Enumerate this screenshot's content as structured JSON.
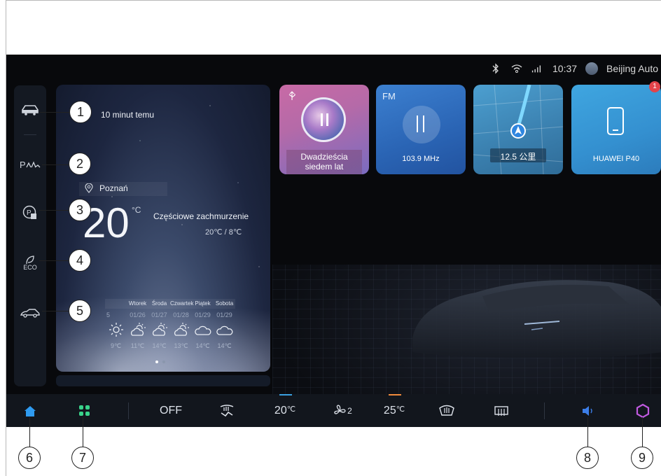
{
  "status_bar": {
    "time": "10:37",
    "profile": "Beijing Auto",
    "bluetooth_icon": "bluetooth-icon",
    "wifi_icon": "wifi-icon",
    "signal_icon": "signal-icon"
  },
  "side_menu": {
    "items": [
      {
        "name": "vehicle-icon"
      },
      {
        "name": "parking-assist-icon",
        "text": "P"
      },
      {
        "name": "auto-park-icon"
      },
      {
        "name": "eco-icon",
        "text": "ECO"
      },
      {
        "name": "vehicle-side-icon"
      }
    ]
  },
  "weather": {
    "updated": "10 minut temu",
    "city": "Poznań",
    "temperature": "20",
    "unit": "°C",
    "condition": "Częściowe zachmurzenie",
    "range": "20℃ / 8℃",
    "forecast": [
      {
        "day": "",
        "date": "5",
        "icon": "sun-icon",
        "temp": "9℃"
      },
      {
        "day": "Wtorek",
        "date": "01/26",
        "icon": "partly-cloudy-icon",
        "temp": "11℃"
      },
      {
        "day": "Środa",
        "date": "01/27",
        "icon": "partly-cloudy-icon",
        "temp": "14℃"
      },
      {
        "day": "Czwartek",
        "date": "01/28",
        "icon": "partly-cloudy-icon",
        "temp": "13℃"
      },
      {
        "day": "Piątek",
        "date": "01/29",
        "icon": "cloud-icon",
        "temp": "14℃"
      },
      {
        "day": "Sobota",
        "date": "01/29",
        "icon": "cloud-icon",
        "temp": "14℃"
      }
    ],
    "page_count": 2,
    "active_page": 1
  },
  "cards": {
    "music": {
      "title": "Dwadzieścia\nsiedem lat",
      "usb_icon": "usb-icon"
    },
    "fm": {
      "label": "FM",
      "frequency": "103.9 MHz"
    },
    "nav": {
      "distance": "12.5 公里"
    },
    "phone": {
      "device": "HUAWEI P40",
      "badge": "1"
    }
  },
  "bottom_bar": {
    "ac_off": "OFF",
    "temp_left": "20",
    "temp_right": "25",
    "temp_unit": "℃",
    "fan_level": "2",
    "accent_left": "#3aa0e0",
    "accent_right": "#f08a3c"
  },
  "callouts": [
    "1",
    "2",
    "3",
    "4",
    "5",
    "6",
    "7",
    "8",
    "9"
  ]
}
